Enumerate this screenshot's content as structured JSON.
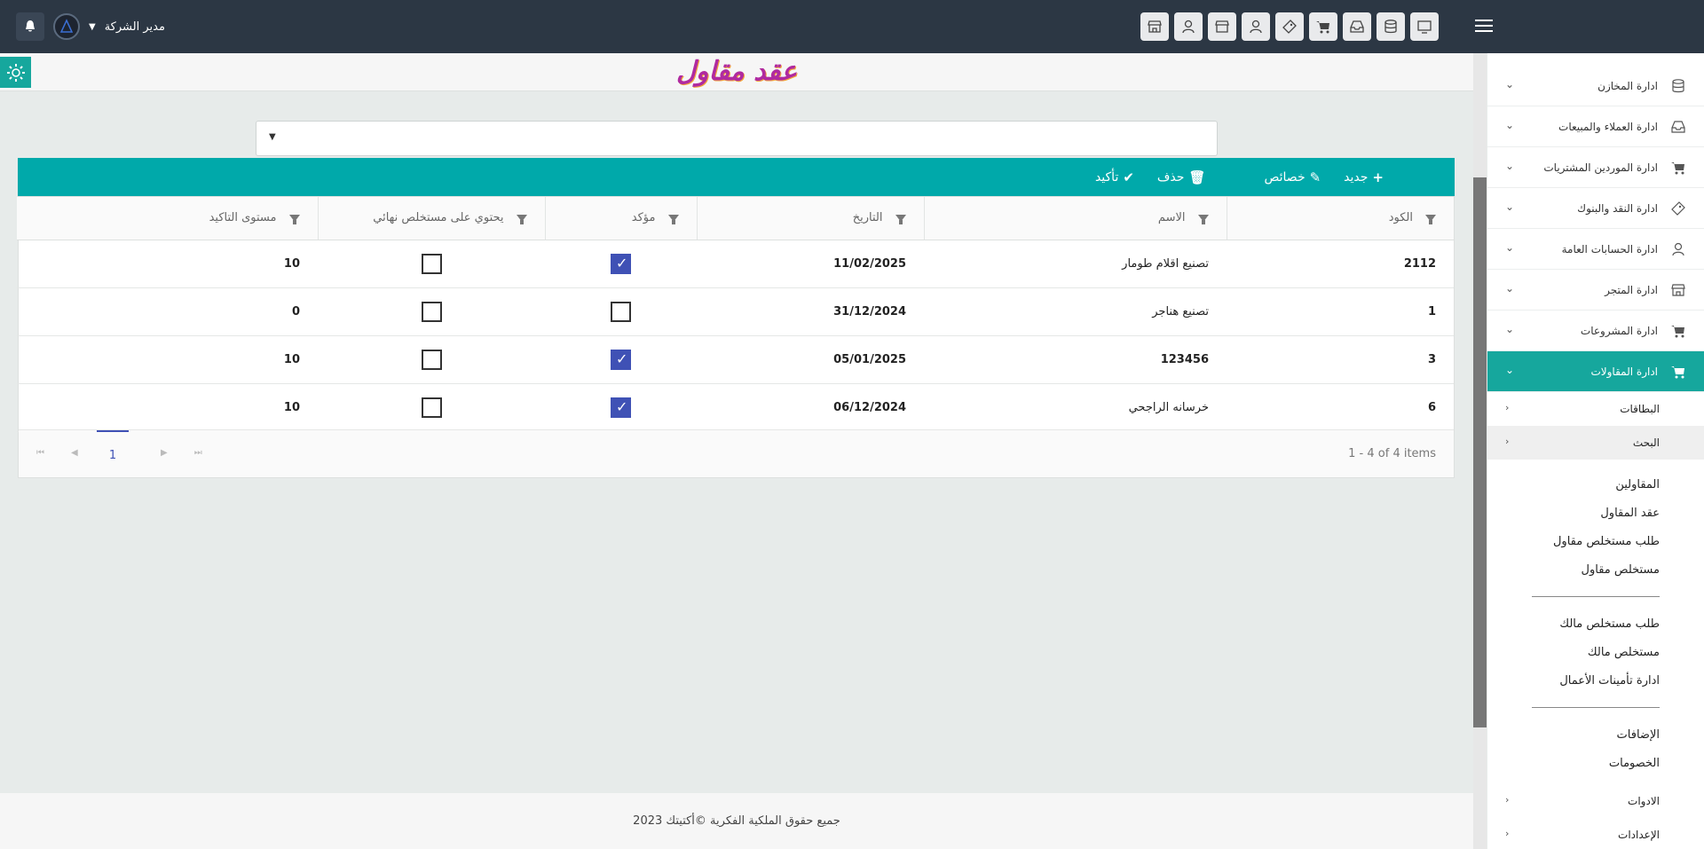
{
  "topbar": {
    "user_name": "مدير الشركة",
    "icons": [
      "monitor-icon",
      "database-icon",
      "inbox-icon",
      "cart-icon",
      "tag-icon",
      "user-icon",
      "store-icon",
      "user-icon",
      "store-icon"
    ]
  },
  "page": {
    "title": "عقد مقاول",
    "dropdown_value": ""
  },
  "toolbar": {
    "new_label": "جديد",
    "properties_label": "خصائص",
    "delete_label": "حذف",
    "confirm_label": "تأكيد"
  },
  "grid": {
    "columns": [
      "الكود",
      "الاسم",
      "التاريخ",
      "مؤكد",
      "يحتوي على مستخلص نهائي",
      "مستوى التاكيد"
    ],
    "rows": [
      {
        "code": "2112",
        "name": "تصنيع اقلام طومار",
        "date": "11/02/2025",
        "confirmed": true,
        "has_final": false,
        "level": "10"
      },
      {
        "code": "1",
        "name": "تصنيع هناجر",
        "date": "31/12/2024",
        "confirmed": false,
        "has_final": false,
        "level": "0"
      },
      {
        "code": "3",
        "name": "123456",
        "date": "05/01/2025",
        "confirmed": true,
        "has_final": false,
        "level": "10"
      },
      {
        "code": "6",
        "name": "خرسانه الراجحي",
        "date": "06/12/2024",
        "confirmed": true,
        "has_final": false,
        "level": "10"
      }
    ],
    "pager": {
      "current_page": "1",
      "info": "1 - 4 of 4 items"
    }
  },
  "footer": {
    "text": "جميع حقوق الملكية الفكرية ©أكتيتك 2023"
  },
  "sidebar": {
    "items": [
      {
        "label": "ادارة المخازن",
        "icon": "database-icon"
      },
      {
        "label": "ادارة العملاء والمبيعات",
        "icon": "inbox-icon"
      },
      {
        "label": "ادارة الموردين المشتريات",
        "icon": "cart-icon"
      },
      {
        "label": "ادارة النقد والبنوك",
        "icon": "tag-icon"
      },
      {
        "label": "ادارة الحسابات العامة",
        "icon": "user-icon"
      },
      {
        "label": "ادارة المتجر",
        "icon": "store-icon"
      },
      {
        "label": "ادارة المشروعات",
        "icon": "cart-icon"
      },
      {
        "label": "ادارة المقاولات",
        "icon": "cart-icon"
      }
    ],
    "sub_cards": "البطاقات",
    "sub_search": "البحث",
    "links_a": [
      "المقاولين",
      "عقد المقاول",
      "طلب مستخلص مقاول",
      "مستخلص مقاول"
    ],
    "links_b": [
      "طلب مستخلص مالك",
      "مستخلص مالك",
      "ادارة تأمينات الأعمال"
    ],
    "links_c": [
      "الإضافات",
      "الخصومات"
    ],
    "sub_tools": "الادوات",
    "sub_settings": "الإعدادات"
  },
  "colors": {
    "topbar": "#2c3744",
    "accent": "#00a9aa",
    "active_menu": "#16a79d",
    "checkbox": "#3f51b5",
    "title": "#b02aa0"
  }
}
